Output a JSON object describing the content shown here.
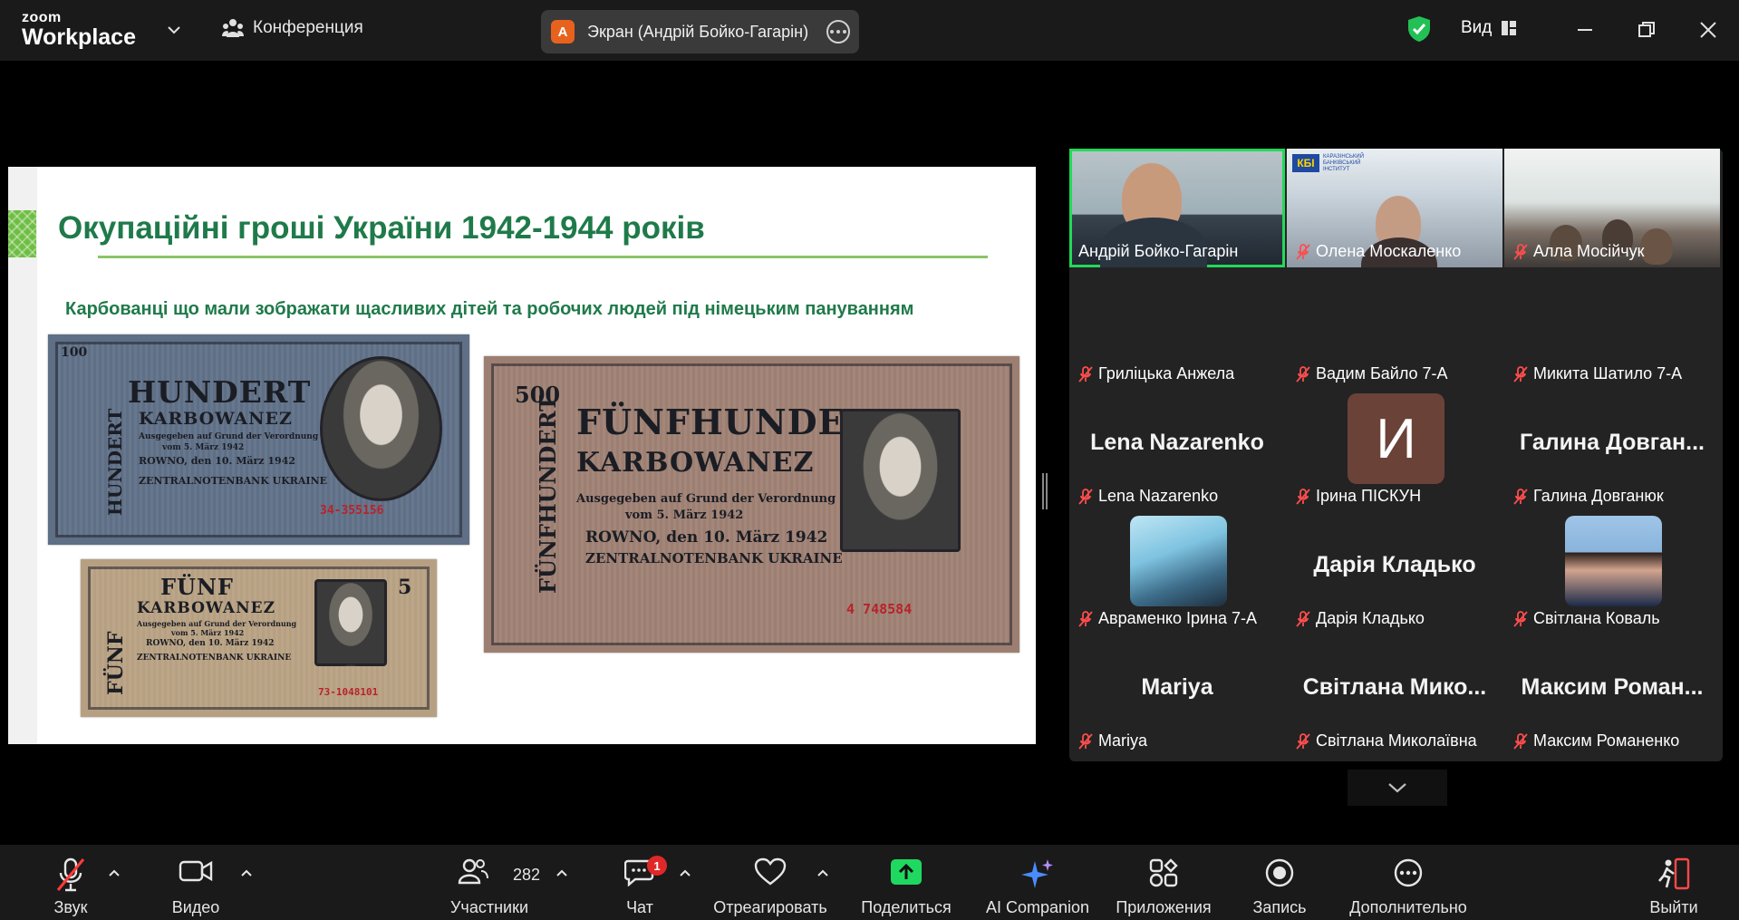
{
  "app": {
    "brand_small": "zoom",
    "brand_name": "Workplace",
    "meeting_label": "Конференция",
    "screen_share_initial": "A",
    "screen_share_label": "Экран (Андрій Бойко-Гагарін)",
    "view_label": "Вид"
  },
  "slide": {
    "title": "Окупаційні гроші України 1942-1944 років",
    "subtitle": "Карбованці що мали зображати щасливих дітей та робочих людей під німецьким пануванням",
    "note_100": {
      "line1": "HUNDERT",
      "line2": "KARBOWANEZ",
      "text1": "Ausgegeben auf Grund der Verordnung",
      "text2": "vom 5. März 1942",
      "text3": "ROWNO, den 10. März 1942",
      "text4": "ZENTRALNOTENBANK UKRAINE",
      "side": "HUNDERT",
      "corner": "100",
      "serial": "34-355156"
    },
    "note_5": {
      "line1": "FÜNF",
      "line2": "KARBOWANEZ",
      "text1": "Ausgegeben auf Grund der Verordnung",
      "text2": "vom 5. März 1942",
      "text3": "ROWNO, den 10. März 1942",
      "text4": "ZENTRALNOTENBANK UKRAINE",
      "side": "FÜNF",
      "corner": "5",
      "serial": "73-1048101"
    },
    "note_500": {
      "line1": "FÜNFHUNDERT",
      "line2": "KARBOWANEZ",
      "text1": "Ausgegeben auf Grund der Verordnung",
      "text2": "vom 5. März 1942",
      "text3": "ROWNO, den 10. März 1942",
      "text4": "ZENTRALNOTENBANK UKRAINE",
      "side": "FÜNFHUNDERT",
      "corner": "500",
      "serial": "4 748584"
    }
  },
  "participants": [
    {
      "name": "Андрій Бойко-Гагарін",
      "type": "video",
      "active": true,
      "muted": false
    },
    {
      "name": "Олена Москаленко",
      "type": "video",
      "muted": true
    },
    {
      "name": "Алла Мосійчук",
      "type": "video",
      "muted": true
    },
    {
      "name": "Гриліцька Анжела",
      "type": "empty",
      "muted": true
    },
    {
      "name": "Вадим Байло 7-А",
      "type": "empty",
      "muted": true
    },
    {
      "name": "Микита Шатило 7-А",
      "type": "empty",
      "muted": true
    },
    {
      "name": "Lena Nazarenko",
      "big": "Lena Nazarenko",
      "type": "bigname",
      "muted": true
    },
    {
      "name": "Ірина ПІСКУН",
      "letter": "И",
      "type": "letter",
      "muted": true
    },
    {
      "name": "Галина Довганюк",
      "big": "Галина  Довган...",
      "type": "bigname",
      "muted": true
    },
    {
      "name": "Авраменко Ірина 7-А",
      "type": "avatar",
      "muted": true
    },
    {
      "name": "Дарія Кладько",
      "big": "Дарія Кладько",
      "type": "bigname",
      "muted": true
    },
    {
      "name": "Світлана Коваль",
      "type": "avatar2",
      "muted": true
    },
    {
      "name": "Mariya",
      "big": "Mariya",
      "type": "bigname",
      "muted": true
    },
    {
      "name": "Світлана Миколаївна",
      "big": "Світлана  Мико...",
      "type": "bigname",
      "muted": true
    },
    {
      "name": "Максим Романенко",
      "big": "Максим  Роман...",
      "type": "bigname",
      "muted": true
    }
  ],
  "building_sign": "КБІ",
  "building_text": "КАРАЗІНСЬКИЙ БАНКІВСЬКИЙ ІНСТИТУТ",
  "toolbar": {
    "audio": "Звук",
    "video": "Видео",
    "participants": "Участники",
    "participants_count": "282",
    "chat": "Чат",
    "chat_badge": "1",
    "react": "Отреагировать",
    "share": "Поделиться",
    "ai": "AI Companion",
    "apps": "Приложения",
    "record": "Запись",
    "more": "Дополнительно",
    "leave": "Выйти"
  },
  "colors": {
    "accent_green": "#23d959",
    "share_green": "#1fd860",
    "slide_title": "#1f7a4a",
    "badge_red": "#e02828"
  }
}
